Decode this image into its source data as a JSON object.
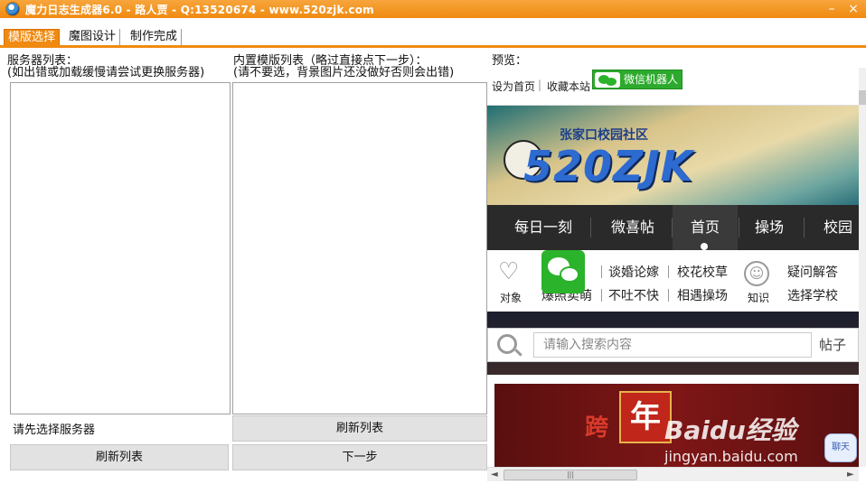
{
  "window": {
    "title": "魔力日志生成器6.0  - 路人贾  - Q:13520674  - www.520zjk.com",
    "minimize_label": "–",
    "close_label": "×"
  },
  "tabs": [
    {
      "label": "模版选择",
      "active": true
    },
    {
      "label": "魔图设计",
      "active": false
    },
    {
      "label": "制作完成",
      "active": false
    }
  ],
  "server_panel": {
    "title": "服务器列表：",
    "hint": "(如出错或加载缓慢请尝试更换服务器)",
    "status": "请先选择服务器",
    "refresh_label": "刷新列表"
  },
  "template_panel": {
    "title": "内置模版列表（略过直接点下一步）：",
    "hint": "(请不要选，背景图片还没做好否则会出错)",
    "refresh_label": "刷新列表",
    "next_label": "下一步"
  },
  "preview": {
    "title": "预览：",
    "links": [
      "设为首页",
      "收藏本站"
    ],
    "wechat_button": "微信机器人",
    "banner": {
      "subtitle": "张家口校园社区",
      "logo": "520ZJK"
    },
    "nav": [
      "每日一刻",
      "微喜帖",
      "首页",
      "操场",
      "校园"
    ],
    "nav_active": "首页",
    "categories": {
      "icon1_label": "对象",
      "icon2_label": "知识",
      "row1": [
        "爱",
        "谈婚论嫁",
        "校花校草",
        "疑问解答"
      ],
      "row2": [
        "爆照卖萌",
        "不吐不快",
        "相遇操场",
        "选择学校"
      ]
    },
    "search": {
      "placeholder": "请输入搜索内容",
      "scope": "帖子"
    },
    "ad": {
      "badge": "年",
      "text_left": "跨"
    },
    "watermark": {
      "brand": "Baidu经验",
      "url": "jingyan.baidu.com"
    },
    "chat_label": "聊天"
  },
  "colors": {
    "accent": "#f08a10",
    "wechat": "#2bb32b",
    "nav_bg": "#2a2a2a"
  }
}
